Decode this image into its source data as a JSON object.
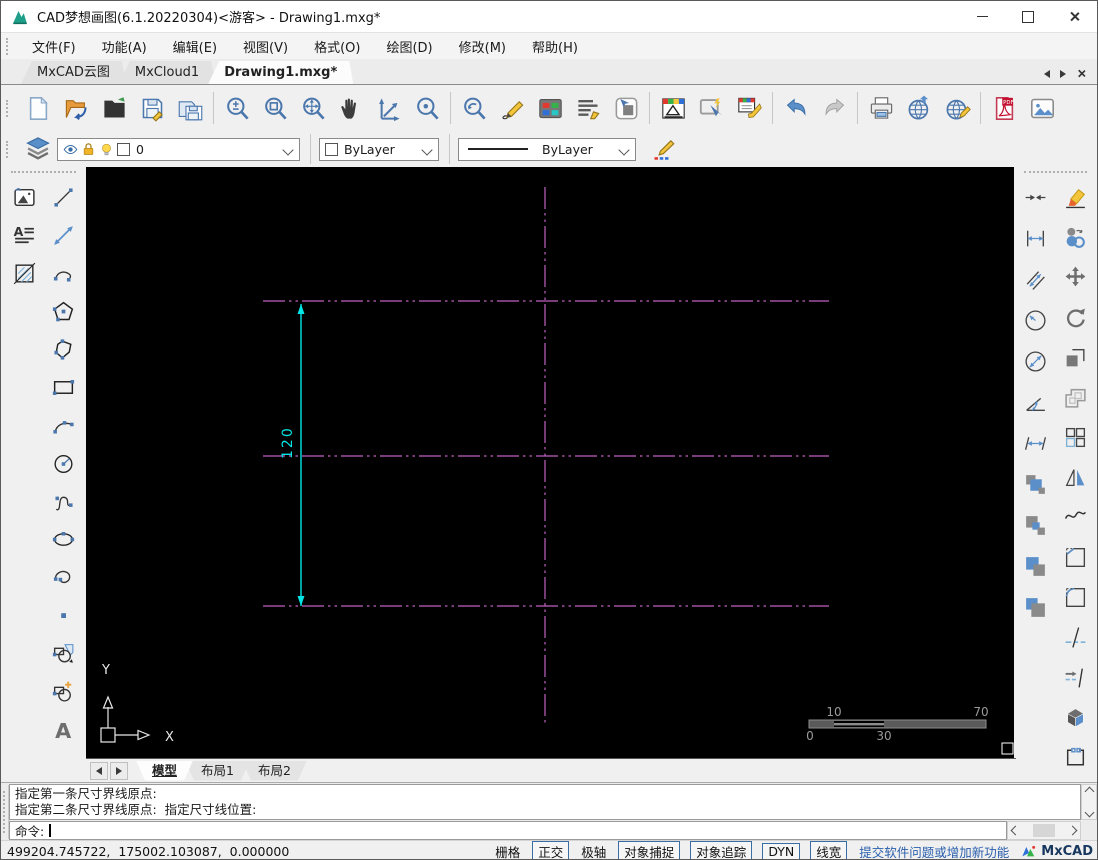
{
  "window": {
    "title": "CAD梦想画图(6.1.20220304)<游客> - Drawing1.mxg*"
  },
  "menu": {
    "items": [
      {
        "id": "file",
        "label": "文件(F)"
      },
      {
        "id": "function",
        "label": "功能(A)"
      },
      {
        "id": "edit",
        "label": "编辑(E)"
      },
      {
        "id": "view",
        "label": "视图(V)"
      },
      {
        "id": "format",
        "label": "格式(O)"
      },
      {
        "id": "draw",
        "label": "绘图(D)"
      },
      {
        "id": "modify",
        "label": "修改(M)"
      },
      {
        "id": "help",
        "label": "帮助(H)"
      }
    ]
  },
  "doc_tabs": {
    "items": [
      {
        "id": "mxcad-cloud",
        "label": "MxCAD云图",
        "active": false
      },
      {
        "id": "mxcloud1",
        "label": "MxCloud1",
        "active": false
      },
      {
        "id": "drawing1",
        "label": "Drawing1.mxg*",
        "active": true
      }
    ]
  },
  "toolbar": {
    "buttons": [
      "new-file",
      "open-drawing",
      "open-folder",
      "save",
      "save-as",
      "|",
      "zoom-dynamic",
      "zoom-window",
      "zoom-extents",
      "pan",
      "axes",
      "zoom-center",
      "|",
      "zoom-previous",
      "sketch",
      "palette",
      "text-style",
      "point-style",
      "|",
      "dim-style",
      "select-objects",
      "match-properties",
      "|",
      "undo",
      "redo",
      "|",
      "print",
      "publish-web",
      "edit-web",
      "|",
      "export-pdf",
      "insert-image"
    ]
  },
  "properties_bar": {
    "layer": {
      "value": "0"
    },
    "color": {
      "value": "ByLayer"
    },
    "linetype": {
      "value": "ByLayer"
    }
  },
  "left_toolbar": {
    "col1": [
      "raster-image",
      "multiline-text",
      "hatch"
    ],
    "col2": [
      "line",
      "construction-line",
      "ray-arc",
      "polygon",
      "irregular-polygon",
      "rectangle",
      "arc-3pt",
      "circle",
      "spline",
      "ellipse",
      "revision-arc",
      "point",
      "insert-block",
      "create-block",
      "single-text"
    ]
  },
  "right_toolbar": {
    "dimension_col": [
      "dim-quick",
      "dim-linear",
      "dim-aligned",
      "dim-radius",
      "dim-diameter",
      "dim-angular",
      "dim-continue",
      "draw-order-front",
      "draw-order-back",
      "draw-order-above",
      "draw-order-below"
    ],
    "modify_col": [
      "erase",
      "copy",
      "move",
      "rotate",
      "stretch",
      "offset",
      "array",
      "mirror",
      "edit-polyline",
      "chamfer",
      "fillet",
      "trim",
      "extend",
      "explode",
      "break"
    ]
  },
  "canvas": {
    "background": "#000000",
    "centerline_color": "#c060c0",
    "dimension_color": "#00e5e5",
    "dimension_text": "120",
    "ucs": {
      "x_label": "X",
      "y_label": "Y"
    },
    "scale_bar": {
      "top_left": "10",
      "top_right": "70",
      "bottom_left": "0",
      "bottom_mid": "30"
    }
  },
  "sheet_tabs": {
    "items": [
      {
        "id": "model",
        "label": "模型",
        "active": true
      },
      {
        "id": "layout1",
        "label": "布局1",
        "active": false
      },
      {
        "id": "layout2",
        "label": "布局2",
        "active": false
      }
    ]
  },
  "command": {
    "history": [
      "指定第一条尺寸界线原点:",
      "指定第二条尺寸界线原点:  指定尺寸线位置:"
    ],
    "prompt": "命令:"
  },
  "statusbar": {
    "coordinates": "499204.745722,  175002.103087,  0.000000",
    "toggles": [
      {
        "id": "grid",
        "label": "栅格",
        "boxed": false
      },
      {
        "id": "ortho",
        "label": "正交",
        "boxed": true
      },
      {
        "id": "polar",
        "label": "极轴",
        "boxed": false
      },
      {
        "id": "osnap",
        "label": "对象捕捉",
        "boxed": true
      },
      {
        "id": "otrack",
        "label": "对象追踪",
        "boxed": true
      },
      {
        "id": "dyn",
        "label": "DYN",
        "boxed": true
      },
      {
        "id": "lineweight",
        "label": "线宽",
        "boxed": true
      }
    ],
    "feedback_link": "提交软件问题或增加新功能",
    "brand": "MxCAD"
  }
}
